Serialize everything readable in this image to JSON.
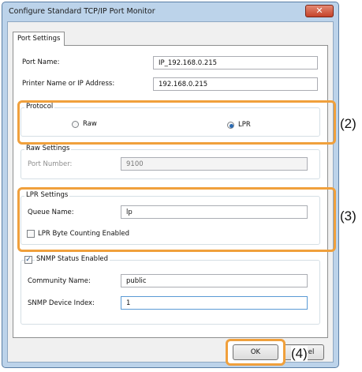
{
  "window": {
    "title": "Configure Standard TCP/IP Port Monitor",
    "close_glyph": "✕"
  },
  "tab": {
    "label": "Port Settings"
  },
  "port_name": {
    "label": "Port Name:",
    "value": "IP_192.168.0.215"
  },
  "printer_name": {
    "label": "Printer Name or IP Address:",
    "value": "192.168.0.215"
  },
  "protocol": {
    "title": "Protocol",
    "raw_label": "Raw",
    "lpr_label": "LPR",
    "selected": "LPR",
    "callout": "(2)"
  },
  "raw_settings": {
    "title": "Raw Settings",
    "port_number_label": "Port Number:",
    "port_number_value": "9100"
  },
  "lpr_settings": {
    "title": "LPR Settings",
    "queue_name_label": "Queue Name:",
    "queue_name_value": "lp",
    "byte_counting_label": "LPR Byte Counting Enabled",
    "byte_counting_checked": false,
    "callout": "(3)"
  },
  "snmp": {
    "enabled_label": "SNMP Status Enabled",
    "enabled_checked": true,
    "community_label": "Community Name:",
    "community_value": "public",
    "device_index_label": "SNMP Device Index:",
    "device_index_value": "1"
  },
  "buttons": {
    "ok_label": "OK",
    "cancel_label": "Cancel",
    "callout": "(4)"
  },
  "colors": {
    "highlight": "#f0a03c",
    "title_bar": "#bcd3ea",
    "close_button": "#c5432a"
  }
}
